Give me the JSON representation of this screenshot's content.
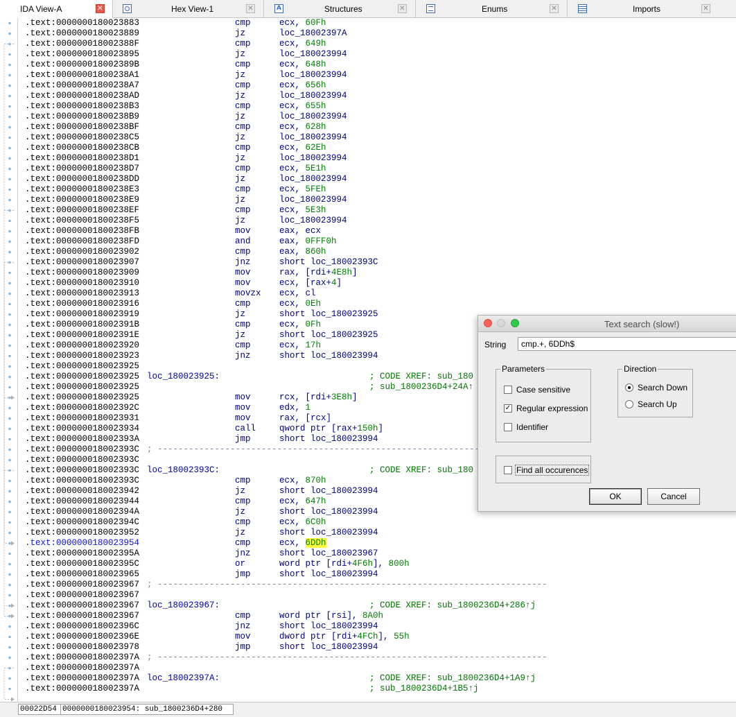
{
  "tabs": [
    {
      "label": "IDA View-A",
      "icon": "close-icon",
      "active": true
    },
    {
      "label": "Hex View-1",
      "icon": "hex-view-icon"
    },
    {
      "label": "Structures",
      "icon": "structures-icon"
    },
    {
      "label": "Enums",
      "icon": "enums-icon"
    },
    {
      "label": "Imports",
      "icon": "imports-icon"
    }
  ],
  "listing": [
    {
      "addr": ".text:0000000180023883",
      "mn": "cmp",
      "op": "ecx, ",
      "num": "60Fh"
    },
    {
      "addr": ".text:0000000180023889",
      "mn": "jz",
      "sym": "loc_18002397A"
    },
    {
      "addr": ".text:000000018002388F",
      "mn": "cmp",
      "op": "ecx, ",
      "num": "649h"
    },
    {
      "addr": ".text:0000000180023895",
      "mn": "jz",
      "sym": "loc_180023994"
    },
    {
      "addr": ".text:000000018002389B",
      "mn": "cmp",
      "op": "ecx, ",
      "num": "648h"
    },
    {
      "addr": ".text:00000001800238A1",
      "mn": "jz",
      "sym": "loc_180023994"
    },
    {
      "addr": ".text:00000001800238A7",
      "mn": "cmp",
      "op": "ecx, ",
      "num": "656h"
    },
    {
      "addr": ".text:00000001800238AD",
      "mn": "jz",
      "sym": "loc_180023994"
    },
    {
      "addr": ".text:00000001800238B3",
      "mn": "cmp",
      "op": "ecx, ",
      "num": "655h"
    },
    {
      "addr": ".text:00000001800238B9",
      "mn": "jz",
      "sym": "loc_180023994"
    },
    {
      "addr": ".text:00000001800238BF",
      "mn": "cmp",
      "op": "ecx, ",
      "num": "628h"
    },
    {
      "addr": ".text:00000001800238C5",
      "mn": "jz",
      "sym": "loc_180023994"
    },
    {
      "addr": ".text:00000001800238CB",
      "mn": "cmp",
      "op": "ecx, ",
      "num": "62Eh"
    },
    {
      "addr": ".text:00000001800238D1",
      "mn": "jz",
      "sym": "loc_180023994"
    },
    {
      "addr": ".text:00000001800238D7",
      "mn": "cmp",
      "op": "ecx, ",
      "num": "5E1h"
    },
    {
      "addr": ".text:00000001800238DD",
      "mn": "jz",
      "sym": "loc_180023994"
    },
    {
      "addr": ".text:00000001800238E3",
      "mn": "cmp",
      "op": "ecx, ",
      "num": "5FEh"
    },
    {
      "addr": ".text:00000001800238E9",
      "mn": "jz",
      "sym": "loc_180023994"
    },
    {
      "addr": ".text:00000001800238EF",
      "mn": "cmp",
      "op": "ecx, ",
      "num": "5E3h"
    },
    {
      "addr": ".text:00000001800238F5",
      "mn": "jz",
      "sym": "loc_180023994"
    },
    {
      "addr": ".text:00000001800238FB",
      "mn": "mov",
      "op": "eax, ecx"
    },
    {
      "addr": ".text:00000001800238FD",
      "mn": "and",
      "op": "eax, ",
      "num": "0FFF0h"
    },
    {
      "addr": ".text:0000000180023902",
      "mn": "cmp",
      "op": "eax, ",
      "num": "860h"
    },
    {
      "addr": ".text:0000000180023907",
      "mn": "jnz",
      "op": "short ",
      "sym": "loc_18002393C"
    },
    {
      "addr": ".text:0000000180023909",
      "mn": "mov",
      "op": "rax, [rdi+",
      "num": "4E8h",
      "op2": "]"
    },
    {
      "addr": ".text:0000000180023910",
      "mn": "mov",
      "op": "ecx, [rax+",
      "num": "4",
      "op2": "]"
    },
    {
      "addr": ".text:0000000180023913",
      "mn": "movzx",
      "op": "ecx, cl"
    },
    {
      "addr": ".text:0000000180023916",
      "mn": "cmp",
      "op": "ecx, ",
      "num": "0Eh"
    },
    {
      "addr": ".text:0000000180023919",
      "mn": "jz",
      "op": "short ",
      "sym": "loc_180023925"
    },
    {
      "addr": ".text:000000018002391B",
      "mn": "cmp",
      "op": "ecx, ",
      "num": "0Fh"
    },
    {
      "addr": ".text:000000018002391E",
      "mn": "jz",
      "op": "short ",
      "sym": "loc_180023925"
    },
    {
      "addr": ".text:0000000180023920",
      "mn": "cmp",
      "op": "ecx, ",
      "num": "17h"
    },
    {
      "addr": ".text:0000000180023923",
      "mn": "jnz",
      "op": "short ",
      "sym": "loc_180023994"
    },
    {
      "addr": ".text:0000000180023925"
    },
    {
      "addr": ".text:0000000180023925",
      "label": "loc_180023925:",
      "cmt": "; CODE XREF: sub_180"
    },
    {
      "addr": ".text:0000000180023925",
      "cmt": "; sub_1800236D4+24A↑"
    },
    {
      "addr": ".text:0000000180023925",
      "mn": "mov",
      "op": "rcx, [rdi+",
      "num": "3E8h",
      "op2": "]"
    },
    {
      "addr": ".text:000000018002392C",
      "mn": "mov",
      "op": "edx, ",
      "num": "1"
    },
    {
      "addr": ".text:0000000180023931",
      "mn": "mov",
      "op": "rax, [rcx]"
    },
    {
      "addr": ".text:0000000180023934",
      "mn": "call",
      "op": "qword ptr [rax+",
      "num": "150h",
      "op2": "]"
    },
    {
      "addr": ".text:000000018002393A",
      "mn": "jmp",
      "op": "short ",
      "sym": "loc_180023994"
    },
    {
      "addr": ".text:000000018002393C",
      "sep": "; ---------------------------------------------------------------------------"
    },
    {
      "addr": ".text:000000018002393C"
    },
    {
      "addr": ".text:000000018002393C",
      "label": "loc_18002393C:",
      "cmt": "; CODE XREF: sub_180"
    },
    {
      "addr": ".text:000000018002393C",
      "mn": "cmp",
      "op": "ecx, ",
      "num": "870h"
    },
    {
      "addr": ".text:0000000180023942",
      "mn": "jz",
      "op": "short ",
      "sym": "loc_180023994"
    },
    {
      "addr": ".text:0000000180023944",
      "mn": "cmp",
      "op": "ecx, ",
      "num": "647h"
    },
    {
      "addr": ".text:000000018002394A",
      "mn": "jz",
      "op": "short ",
      "sym": "loc_180023994"
    },
    {
      "addr": ".text:000000018002394C",
      "mn": "cmp",
      "op": "ecx, ",
      "num": "6C0h"
    },
    {
      "addr": ".text:0000000180023952",
      "mn": "jz",
      "op": "short ",
      "sym": "loc_180023994"
    },
    {
      "addr": ".text:0000000180023954",
      "mn": "cmp",
      "op": "ecx, ",
      "num": "6DDh",
      "current": true,
      "highlight": true
    },
    {
      "addr": ".text:000000018002395A",
      "mn": "jnz",
      "op": "short ",
      "sym": "loc_180023967"
    },
    {
      "addr": ".text:000000018002395C",
      "mn": "or",
      "op": "word ptr [rdi+",
      "num": "4F6h",
      "op2": "], ",
      "num2": "800h"
    },
    {
      "addr": ".text:0000000180023965",
      "mn": "jmp",
      "op": "short ",
      "sym": "loc_180023994"
    },
    {
      "addr": ".text:0000000180023967",
      "sep": "; ---------------------------------------------------------------------------"
    },
    {
      "addr": ".text:0000000180023967"
    },
    {
      "addr": ".text:0000000180023967",
      "label": "loc_180023967:",
      "cmt": "; CODE XREF: sub_1800236D4+286↑j"
    },
    {
      "addr": ".text:0000000180023967",
      "mn": "cmp",
      "op": "word ptr [rsi], ",
      "num": "8A0h"
    },
    {
      "addr": ".text:000000018002396C",
      "mn": "jnz",
      "op": "short ",
      "sym": "loc_180023994"
    },
    {
      "addr": ".text:000000018002396E",
      "mn": "mov",
      "op": "dword ptr [rdi+",
      "num": "4FCh",
      "op2": "], ",
      "num2": "55h"
    },
    {
      "addr": ".text:0000000180023978",
      "mn": "jmp",
      "op": "short ",
      "sym": "loc_180023994"
    },
    {
      "addr": ".text:000000018002397A",
      "sep": "; ---------------------------------------------------------------------------"
    },
    {
      "addr": ".text:000000018002397A"
    },
    {
      "addr": ".text:000000018002397A",
      "label": "loc_18002397A:",
      "cmt": "; CODE XREF: sub_1800236D4+1A9↑j"
    },
    {
      "addr": ".text:000000018002397A",
      "cmt": "; sub_1800236D4+1B5↑j"
    }
  ],
  "status": {
    "offset": "00022D54",
    "location": "0000000180023954: sub_1800236D4+280"
  },
  "dialog": {
    "title": "Text search (slow!)",
    "string_label": "String",
    "string_value": "cmp.+, 6DDh$",
    "parameters_title": "Parameters",
    "case_sensitive": "Case sensitive",
    "case_sensitive_checked": false,
    "regex": "Regular expression",
    "regex_checked": true,
    "identifier": "Identifier",
    "identifier_checked": false,
    "direction_title": "Direction",
    "search_down": "Search Down",
    "search_down_selected": true,
    "search_up": "Search Up",
    "search_up_selected": false,
    "find_all": "Find all occurences",
    "find_all_checked": false,
    "ok_label": "OK",
    "cancel_label": "Cancel"
  },
  "colors": {
    "address": "#000000",
    "current_address": "#1010d8",
    "mnemonic": "#000080",
    "number": "#008000",
    "comment": "#007700",
    "highlight": "#ffff40",
    "active_tab_close": "#e65b4c"
  }
}
